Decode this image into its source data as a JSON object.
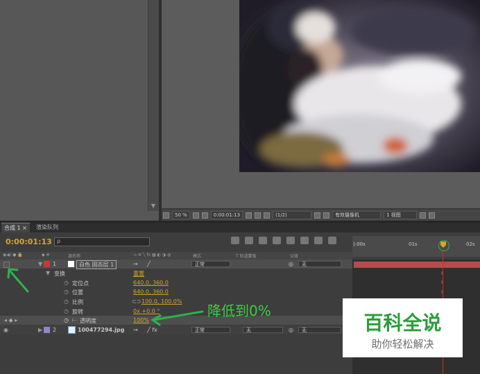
{
  "viewer": {
    "zoom": "50 %",
    "timecode": "0:00:01:13",
    "resolution": "(1/2)",
    "camera": "有效摄像机",
    "views": "1 视图"
  },
  "timeline": {
    "tabs": [
      "合成 1",
      "渲染队列"
    ],
    "timecode": "0:00:01:13",
    "search_placeholder": "ρ",
    "col_source": "源名称",
    "col_mode": "模式",
    "col_trkmat": "T  轨道蒙板",
    "col_parent": "父级",
    "ruler_labels": [
      "):00s",
      "01s",
      "02s"
    ],
    "layer1": {
      "num": "1",
      "name": "白色 固态层 1",
      "mode": "正常",
      "parent": "无"
    },
    "transform": {
      "label": "变换",
      "reset": "重置"
    },
    "properties": [
      {
        "label": "定位点",
        "value": "640.0, 360.0"
      },
      {
        "label": "位置",
        "value": "640.0, 360.0"
      },
      {
        "label": "比例",
        "value": "100.0, 100.0%"
      },
      {
        "label": "旋转",
        "value": "0x +0.0 °"
      },
      {
        "label": "透明度",
        "value": "100%"
      }
    ],
    "layer2": {
      "num": "2",
      "name": "100477294.jpg",
      "mode": "正常",
      "trkmat": "无",
      "parent": "无"
    }
  },
  "annotation": "降低到0%",
  "watermark": {
    "title": "百科全说",
    "subtitle": "助你轻松解决"
  },
  "colors": {
    "accent_gold": "#d4a52b",
    "cti_red": "#d12828",
    "annotation_green": "#3ad13f",
    "layer_bar": "#b94a4a"
  }
}
